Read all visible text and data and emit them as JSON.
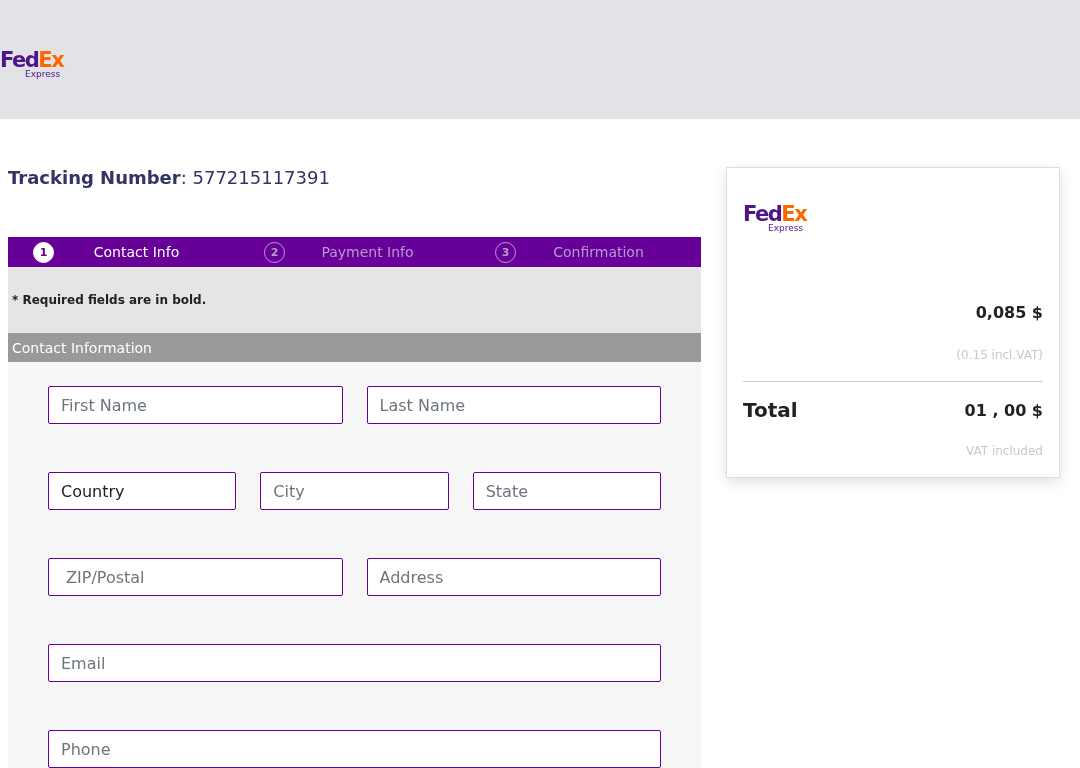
{
  "header": {
    "logo": {
      "word_1": "Fed",
      "word_2": "Ex",
      "subtitle": "Express"
    }
  },
  "tracking": "**Tracking Number**: 577215117391",
  "steps": [
    {
      "number": "1",
      "label": "Contact Info",
      "selected": true
    },
    {
      "number": "2",
      "label": "Payment Info",
      "selected": false
    },
    {
      "number": "3",
      "label": "Confirmation",
      "selected": false
    }
  ],
  "note": "* Required fields are in bold.",
  "section_title": "Contact Information",
  "field_rows": [
    {
      "fields": [
        {
          "placeholder": "First Name"
        },
        {
          "placeholder": "Last Name"
        }
      ]
    },
    {
      "fields": [
        {
          "value": "Country"
        },
        {
          "placeholder": "City"
        },
        {
          "placeholder": "State"
        }
      ]
    },
    {
      "fields": [
        {
          "placeholder": " ZIP/Postal"
        },
        {
          "placeholder": "Address"
        }
      ]
    },
    {
      "fields": [
        {
          "placeholder": "Email"
        }
      ]
    },
    {
      "fields": [
        {
          "placeholder": "Phone"
        }
      ]
    }
  ],
  "summary": {
    "logo": {
      "word_1": "Fed",
      "word_2": "Ex",
      "subtitle": "Express"
    },
    "price": "0,085 $",
    "vat_note": "(0.15 incl.VAT)",
    "total_label": "Total",
    "total_value": "01 , 00 $",
    "total_note": "VAT included"
  }
}
